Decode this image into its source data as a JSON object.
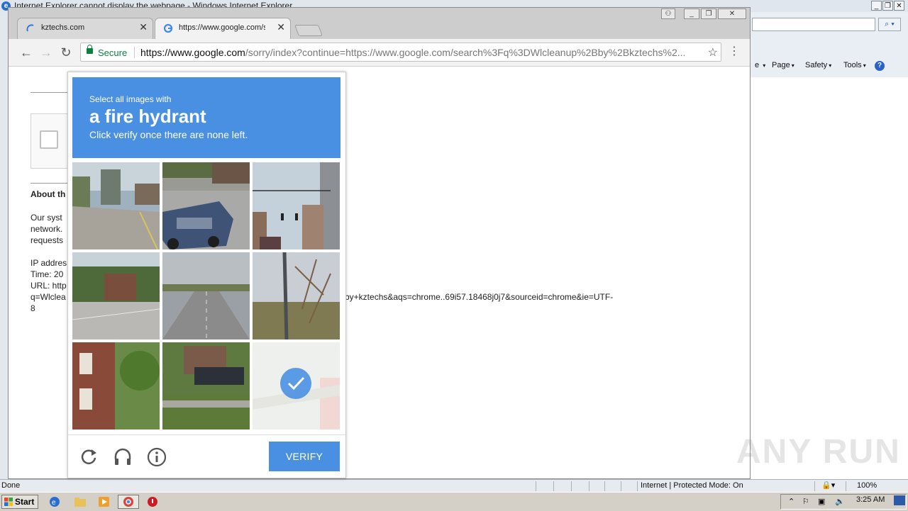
{
  "ie": {
    "title": "Internet Explorer cannot display the webpage - Windows Internet Explorer",
    "command_items": [
      {
        "label": "Page"
      },
      {
        "label": "Safety"
      },
      {
        "label": "Tools"
      }
    ],
    "status_left": "Done",
    "status_zone": "Internet | Protected Mode: On",
    "zoom": "100%"
  },
  "chrome": {
    "tabs": [
      {
        "label": "kztechs.com",
        "active": false
      },
      {
        "label": "https://www.google.com/se",
        "active": true
      }
    ],
    "omnibox": {
      "secure_label": "Secure",
      "url_host": "https://www.google.com",
      "url_rest": "/sorry/index?continue=https://www.google.com/search%3Fq%3DWlcleanup%2Bby%2Bkztechs%2..."
    }
  },
  "page": {
    "heading": "About th",
    "para_lines": [
      "Our syst",
      "network.",
      "requests"
    ],
    "ip_line": "IP addres",
    "time_line": "Time: 20",
    "url_line": "URL: http",
    "url_cont": "q=Wlclea",
    "url_tail": "by+kztechs&aqs=chrome..69i57.18468j0j7&sourceid=chrome&ie=UTF-",
    "url_last": "8"
  },
  "captcha": {
    "line1": "Select all images with",
    "line2": "a fire hydrant",
    "line3": "Click verify once there are none left.",
    "verify_label": "VERIFY"
  },
  "taskbar": {
    "start_label": "Start",
    "clock": "3:25 AM"
  },
  "watermark": "ANY RUN"
}
